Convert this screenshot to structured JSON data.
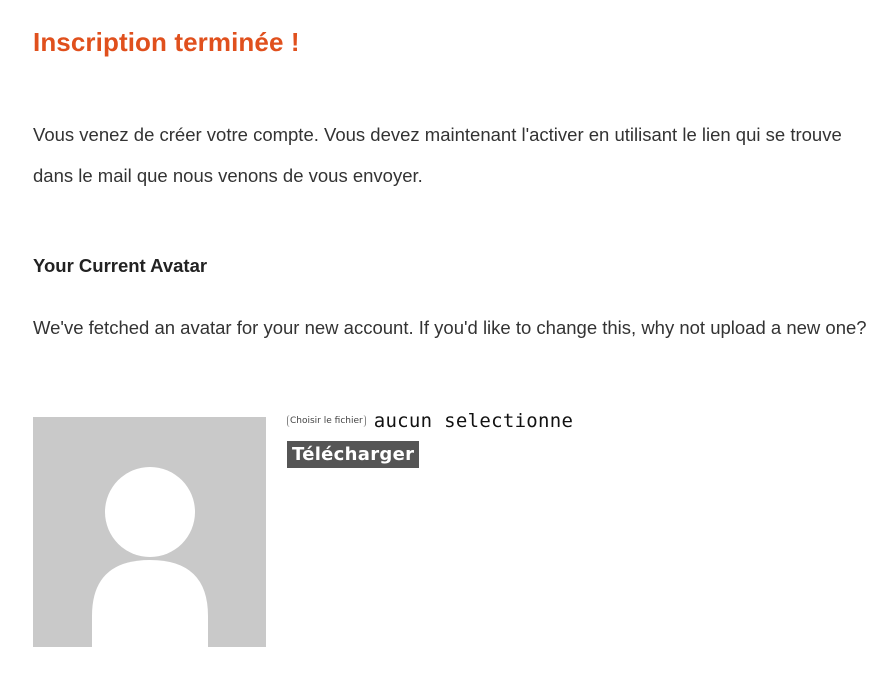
{
  "header": {
    "title": "Inscription terminée !"
  },
  "intro": {
    "text": "Vous venez de créer votre compte. Vous devez maintenant l'activer en utilisant le lien qui se trouve dans le mail que nous venons de vous envoyer."
  },
  "avatar": {
    "heading": "Your Current Avatar",
    "description": "We've fetched an avatar for your new account. If you'd like to change this, why not upload a new one?",
    "image_icon": "default-avatar-silhouette-icon",
    "file_input": {
      "button_label": "Choisir le fichier",
      "status": "aucun selectionne"
    },
    "upload_label": "Télécharger"
  },
  "colors": {
    "title": "#e0501d",
    "text": "#333333",
    "avatar_bg": "#c9c9c9",
    "upload_button_bg": "#555555"
  }
}
